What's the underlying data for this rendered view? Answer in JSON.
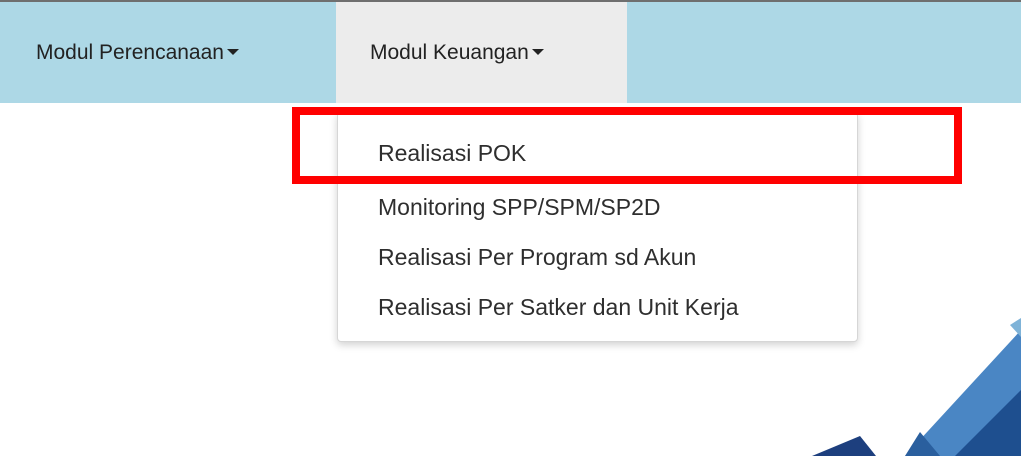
{
  "navbar": {
    "items": [
      {
        "label": "Modul Perencanaan"
      },
      {
        "label": "Modul Keuangan"
      }
    ]
  },
  "dropdown": {
    "items": [
      {
        "label": "Realisasi POK",
        "highlighted": true
      },
      {
        "label": "Monitoring SPP/SPM/SP2D"
      },
      {
        "label": "Realisasi Per Program sd Akun"
      },
      {
        "label": "Realisasi Per Satker dan Unit Kerja"
      }
    ]
  },
  "colors": {
    "navbar_bg": "#add8e6",
    "active_nav_bg": "#ececec",
    "highlight_border": "#ff0000"
  }
}
